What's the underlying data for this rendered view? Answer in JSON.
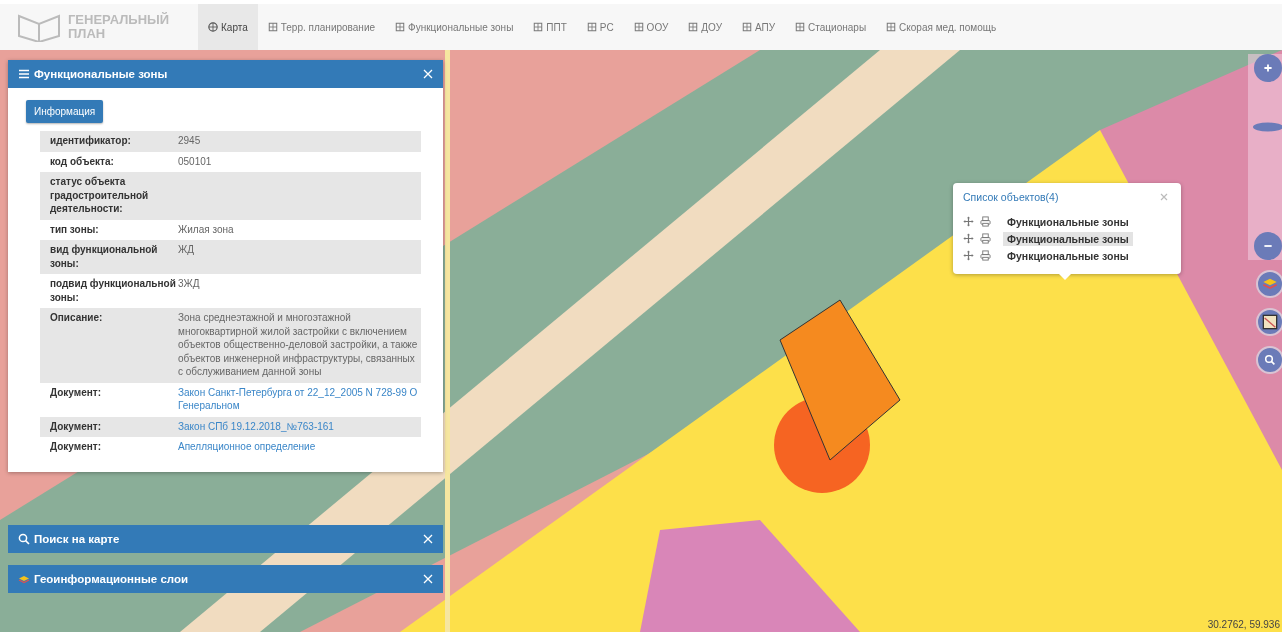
{
  "logo": {
    "line_1": "ГЕНЕРАЛЬНЫЙ",
    "line_2": "ПЛАН"
  },
  "nav": [
    {
      "label": "Карта",
      "selected": true
    },
    {
      "label": "Терр. планирование",
      "selected": false
    },
    {
      "label": "Функциональные зоны",
      "selected": false
    },
    {
      "label": "ППТ",
      "selected": false
    },
    {
      "label": "РС",
      "selected": false
    },
    {
      "label": "ООУ",
      "selected": false
    },
    {
      "label": "ДОУ",
      "selected": false
    },
    {
      "label": "АПУ",
      "selected": false
    },
    {
      "label": "Стационары",
      "selected": false
    },
    {
      "label": "Скорая мед. помощь",
      "selected": false
    }
  ],
  "info_panel": {
    "title": "Функциональные зоны",
    "tab": "Информация",
    "rows": [
      {
        "label": "идентификатор:",
        "value": "2945",
        "kind": "text"
      },
      {
        "label": "код объекта:",
        "value": "050101",
        "kind": "text"
      },
      {
        "label": "статус объекта градостроительной деятельности:",
        "value": "",
        "kind": "text"
      },
      {
        "label": "тип зоны:",
        "value": "Жилая зона",
        "kind": "text"
      },
      {
        "label": "вид функциональной зоны:",
        "value": "ЖД",
        "kind": "text"
      },
      {
        "label": "подвид функциональной зоны:",
        "value": "3ЖД",
        "kind": "text"
      },
      {
        "label": "Описание:",
        "value": "Зона среднеэтажной и многоэтажной многоквартирной жилой застройки с включением объектов общественно-деловой застройки, а также объектов инженерной инфраструктуры, связанных с обслуживанием данной зоны",
        "kind": "text"
      },
      {
        "label": "Документ:",
        "value": "Закон Санкт-Петербурга от 22_12_2005 N 728-99 О Генеральном",
        "kind": "link"
      },
      {
        "label": "Документ:",
        "value": "Закон СПб 19.12.2018_№763-161",
        "kind": "link"
      },
      {
        "label": "Документ:",
        "value": "Апелляционное определение",
        "kind": "link"
      }
    ]
  },
  "collapsed_panels": [
    {
      "title": "Поиск на карте",
      "kind": "search"
    },
    {
      "title": "Геоинформационные слои",
      "kind": "layers"
    }
  ],
  "object_list": {
    "title": "Список объектов(4)",
    "items": [
      {
        "label": "Функциональные зоны",
        "selected": false
      },
      {
        "label": "Функциональные зоны",
        "selected": true
      },
      {
        "label": "Функциональные зоны",
        "selected": false
      }
    ]
  },
  "zoom": {
    "level": 0.7
  },
  "coordinates": "30.2762, 59.936"
}
